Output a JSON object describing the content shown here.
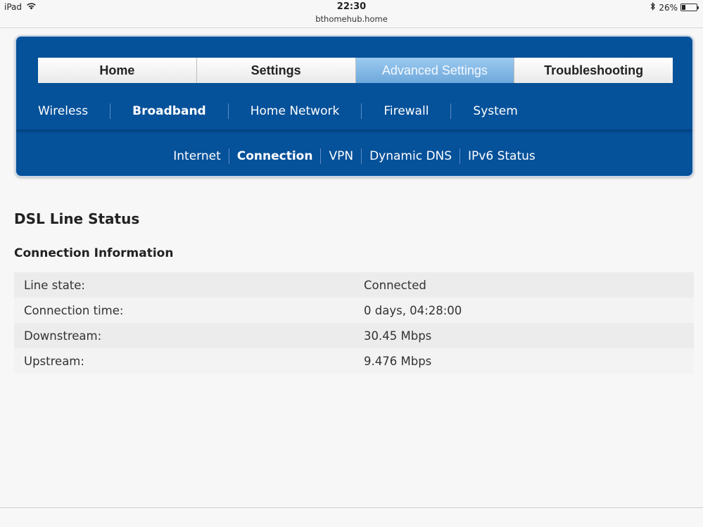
{
  "statusbar": {
    "device": "iPad",
    "time": "22:30",
    "url": "bthomehub.home",
    "battery_percent": "26%",
    "battery_level": 0.26,
    "icons": [
      "wifi-icon",
      "bluetooth-icon",
      "battery-icon"
    ]
  },
  "main_tabs": [
    {
      "label": "Home",
      "active": false
    },
    {
      "label": "Settings",
      "active": false
    },
    {
      "label": "Advanced Settings",
      "active": true
    },
    {
      "label": "Troubleshooting",
      "active": false
    }
  ],
  "sub_nav": [
    {
      "label": "Wireless",
      "active": false
    },
    {
      "label": "Broadband",
      "active": true
    },
    {
      "label": "Home Network",
      "active": false
    },
    {
      "label": "Firewall",
      "active": false
    },
    {
      "label": "System",
      "active": false
    }
  ],
  "sub_sub_nav": [
    {
      "label": "Internet",
      "active": false
    },
    {
      "label": "Connection",
      "active": true
    },
    {
      "label": "VPN",
      "active": false
    },
    {
      "label": "Dynamic DNS",
      "active": false
    },
    {
      "label": "IPv6 Status",
      "active": false
    }
  ],
  "content": {
    "page_title": "DSL Line Status",
    "section_title": "Connection Information",
    "rows": [
      {
        "label": "Line state:",
        "value": "Connected"
      },
      {
        "label": "Connection time:",
        "value": "0 days, 04:28:00"
      },
      {
        "label": "Downstream:",
        "value": "30.45 Mbps"
      },
      {
        "label": "Upstream:",
        "value": "9.476 Mbps"
      }
    ]
  },
  "colors": {
    "panel_blue": "#05519a",
    "active_tab": "#7fb6e4"
  }
}
